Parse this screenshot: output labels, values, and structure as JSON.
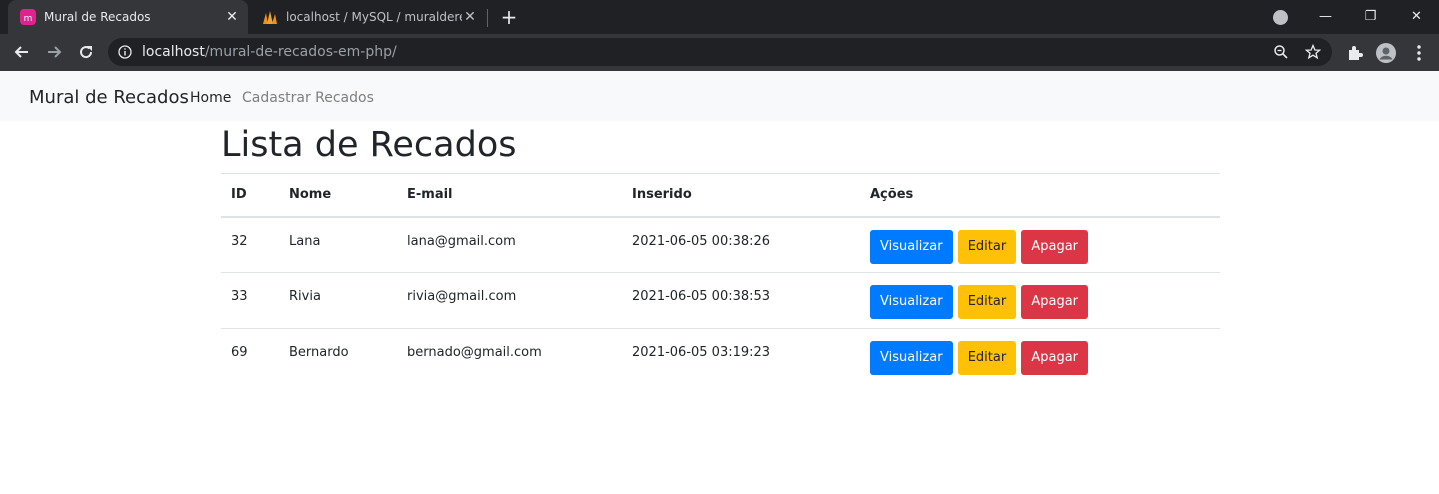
{
  "browser": {
    "tabs": [
      {
        "title": "Mural de Recados",
        "active": true
      },
      {
        "title": "localhost / MySQL / muralderecados",
        "active": false
      }
    ],
    "url_host": "localhost",
    "url_path": "/mural-de-recados-em-php/"
  },
  "navbar": {
    "brand": "Mural de Recados",
    "links": [
      "Home",
      "Cadastrar Recados"
    ]
  },
  "main": {
    "title": "Lista de Recados",
    "table": {
      "headers": [
        "ID",
        "Nome",
        "E-mail",
        "Inserido",
        "Ações"
      ],
      "rows": [
        {
          "id": "32",
          "nome": "Lana",
          "email": "lana@gmail.com",
          "inserido": "2021-06-05 00:38:26"
        },
        {
          "id": "33",
          "nome": "Rivia",
          "email": "rivia@gmail.com",
          "inserido": "2021-06-05 00:38:53"
        },
        {
          "id": "69",
          "nome": "Bernardo",
          "email": "bernado@gmail.com",
          "inserido": "2021-06-05 03:19:23"
        }
      ],
      "actions": {
        "view": "Visualizar",
        "edit": "Editar",
        "delete": "Apagar"
      }
    }
  },
  "colors": {
    "primary": "#007bff",
    "warning": "#ffc107",
    "danger": "#dc3545"
  }
}
